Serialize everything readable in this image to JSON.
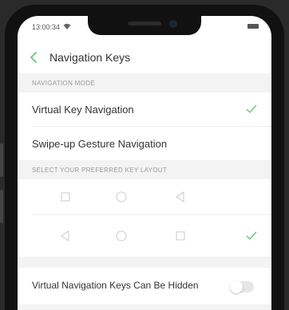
{
  "status": {
    "time": "13:00:34"
  },
  "header": {
    "title": "Navigation Keys"
  },
  "sections": {
    "navigation_mode": "NAVIGATION MODE",
    "key_layout": "SELECT YOUR PREFERRED KEY LAYOUT"
  },
  "navigation_modes": [
    {
      "label": "Virtual Key Navigation",
      "selected": true
    },
    {
      "label": "Swipe-up Gesture Navigation",
      "selected": false
    }
  ],
  "key_layouts": [
    {
      "keys": [
        "square-icon",
        "circle-icon",
        "triangle-left-icon"
      ],
      "selected": false
    },
    {
      "keys": [
        "triangle-left-icon",
        "circle-icon",
        "square-icon"
      ],
      "selected": true
    }
  ],
  "settings": {
    "hide_keys_label": "Virtual Navigation Keys Can Be Hidden",
    "hide_keys_enabled": false
  },
  "colors": {
    "accent": "#6cc47a",
    "glyph": "#cfcfcf",
    "section_bg": "#f3f3f3"
  }
}
